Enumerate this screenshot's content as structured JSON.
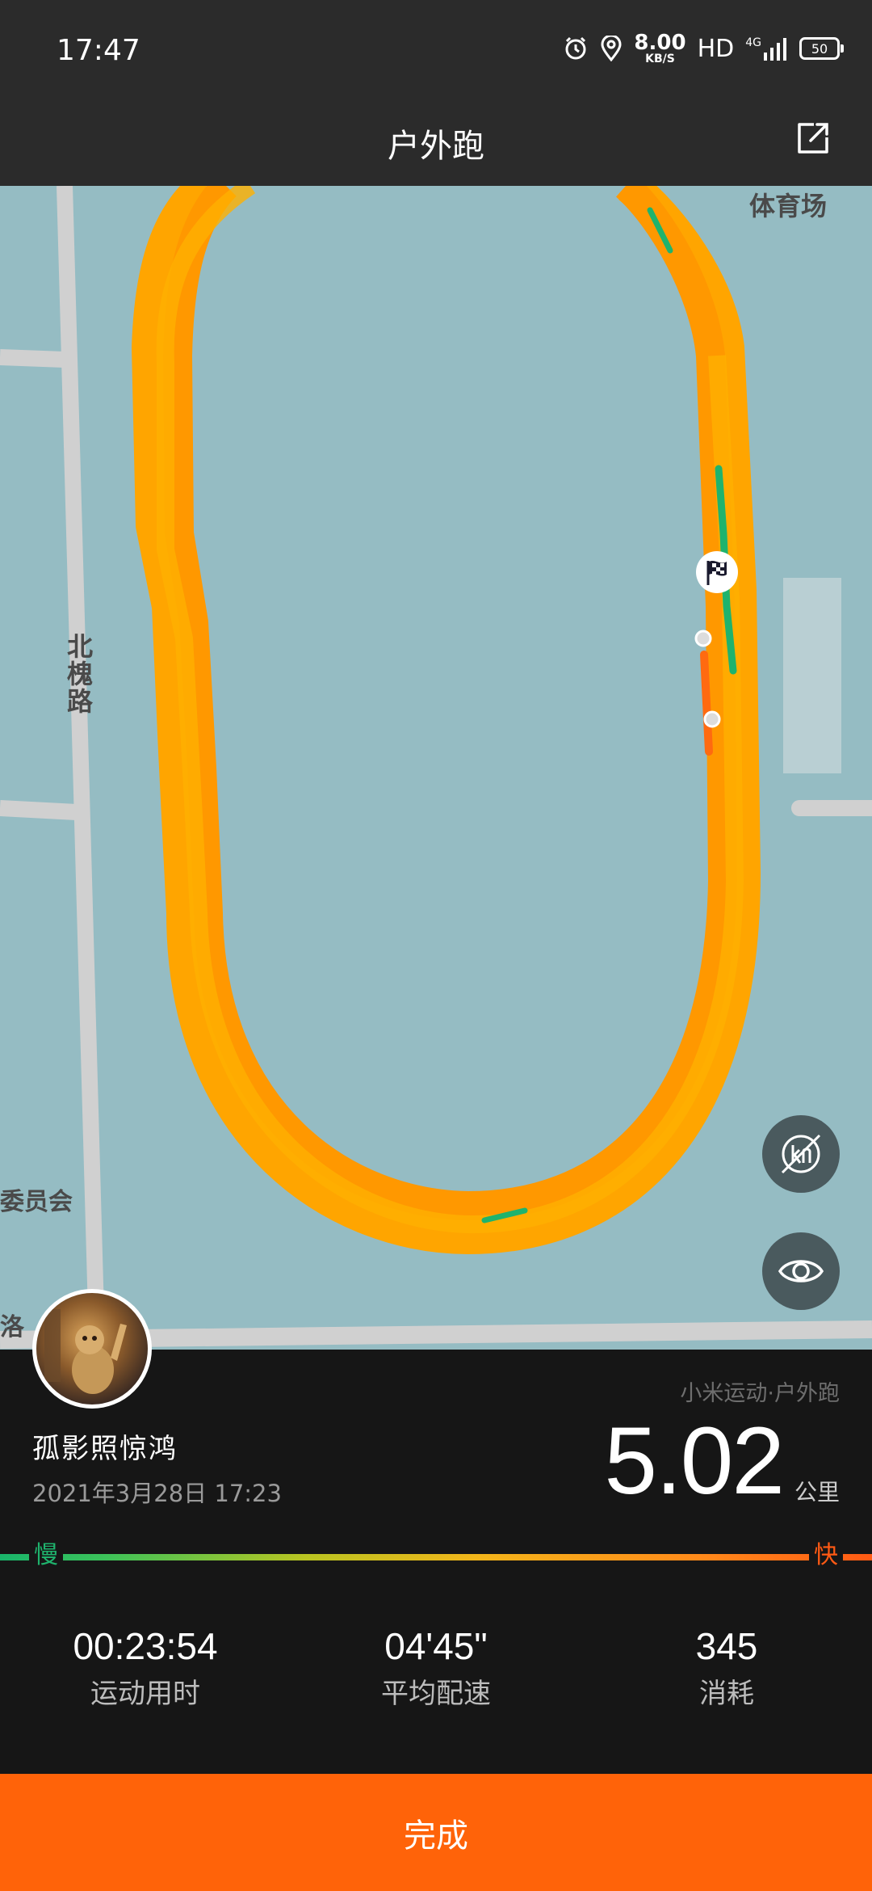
{
  "status_bar": {
    "time": "17:47",
    "net_speed_value": "8.00",
    "net_speed_unit": "KB/S",
    "hd": "HD",
    "network": "4G",
    "battery": "50"
  },
  "header": {
    "title": "户外跑"
  },
  "map": {
    "labels": {
      "venue": "体育场",
      "road": "北槐路",
      "committee": "委员会",
      "partial": "洛"
    },
    "route_color": "#ffa500",
    "fast_segment_color": "#1fb36d",
    "water_color": "#95bcc3"
  },
  "summary": {
    "user_name": "孤影照惊鸿",
    "date": "2021年3月28日  17:23",
    "source": "小米运动·户外跑",
    "distance": "5.02",
    "distance_unit": "公里",
    "slow_label": "慢",
    "fast_label": "快"
  },
  "metrics": [
    {
      "value": "00:23:54",
      "label": "运动用时"
    },
    {
      "value": "04'45\"",
      "label": "平均配速"
    },
    {
      "value": "345",
      "label": "消耗"
    }
  ],
  "done_button": {
    "label": "完成",
    "color": "#ff6309"
  }
}
